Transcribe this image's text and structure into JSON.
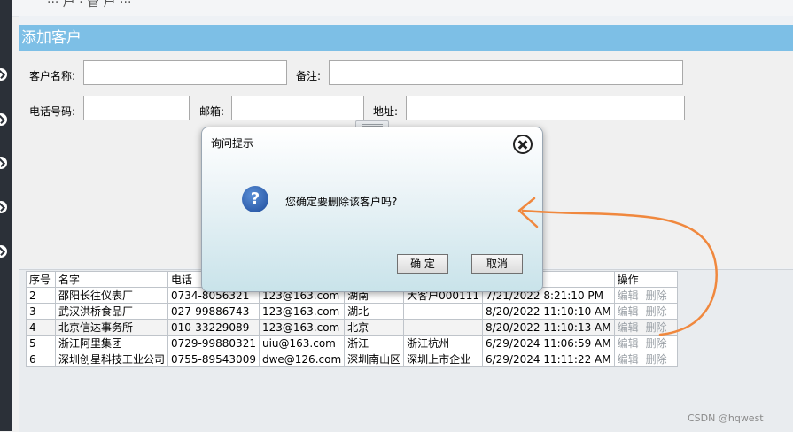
{
  "app": {
    "top_title_fragment": "··· 户 · 管 户 ···"
  },
  "form": {
    "title": "添加客户",
    "customer_name_label": "客户名称:",
    "remark_label": "备注:",
    "phone_label": "电话号码:",
    "email_label": "邮箱:",
    "address_label": "地址:",
    "customer_name_value": "",
    "remark_value": "",
    "phone_value": "",
    "email_value": "",
    "address_value": ""
  },
  "table": {
    "headers": [
      "序号",
      "名字",
      "电话",
      "",
      "",
      "",
      "",
      "操作"
    ],
    "rows": [
      [
        "2",
        "邵阳长往仪表厂",
        "0734-8056321",
        "123@163.com",
        "湖南",
        "大客户000111",
        "7/21/2022 8:21:10 PM"
      ],
      [
        "3",
        "武汉洪桥食品厂",
        "027-99886743",
        "123@163.com",
        "湖北",
        "",
        "8/20/2022 11:10:10 AM"
      ],
      [
        "4",
        "北京信达事务所",
        "010-33229089",
        "123@163.com",
        "北京",
        "",
        "8/20/2022 11:10:13 AM"
      ],
      [
        "5",
        "浙江阿里集团",
        "0729-99880321",
        "uiu@163.com",
        "浙江",
        "浙江杭州",
        "6/29/2024 11:06:59 AM"
      ],
      [
        "6",
        "深圳创星科技工业公司",
        "0755-89543009",
        "dwe@126.com",
        "深圳南山区",
        "深圳上市企业",
        "6/29/2024 11:11:22 AM"
      ]
    ],
    "edit_label": "编辑",
    "delete_label": "删除"
  },
  "dialog": {
    "title": "询问提示",
    "message": "您确定要删除该客户吗?",
    "ok_label": "确 定",
    "cancel_label": "取消",
    "icon": "question-icon"
  },
  "watermark": "CSDN @hqwest",
  "colors": {
    "panel_header": "#7dbfe6",
    "annotation_arrow": "#f0883e",
    "left_bar": "#2b3038"
  }
}
